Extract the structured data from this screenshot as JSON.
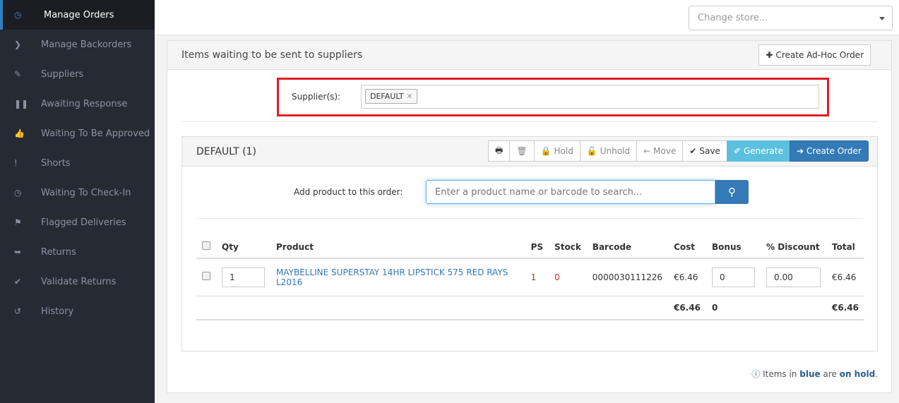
{
  "sidebar": {
    "items": [
      {
        "label": "Manage Orders",
        "icon": "clock-icon",
        "glyph": "◷",
        "active": true
      },
      {
        "label": "Manage Backorders",
        "icon": "chevron-right-icon",
        "glyph": "❯"
      },
      {
        "label": "Suppliers",
        "icon": "edit-icon",
        "glyph": "✎"
      },
      {
        "label": "Awaiting Response",
        "icon": "pause-icon",
        "glyph": "❚❚"
      },
      {
        "label": "Waiting To Be Approved",
        "icon": "thumbs-up-icon",
        "glyph": "👍"
      },
      {
        "label": "Shorts",
        "icon": "exclamation-icon",
        "glyph": "!"
      },
      {
        "label": "Waiting To Check-In",
        "icon": "clock-icon",
        "glyph": "◷"
      },
      {
        "label": "Flagged Deliveries",
        "icon": "flag-icon",
        "glyph": "⚑"
      },
      {
        "label": "Returns",
        "icon": "sign-out-icon",
        "glyph": "➥"
      },
      {
        "label": "Validate Returns",
        "icon": "check-icon",
        "glyph": "✔"
      },
      {
        "label": "History",
        "icon": "history-icon",
        "glyph": "↺"
      }
    ]
  },
  "topbar": {
    "store_placeholder": "Change store..."
  },
  "panel": {
    "title": "Items waiting to be sent to suppliers",
    "adhoc_label": "Create Ad-Hoc Order",
    "supplier_label": "Supplier(s):",
    "supplier_tag": "DEFAULT"
  },
  "order": {
    "title": "DEFAULT (1)",
    "tools": {
      "hold": "Hold",
      "unhold": "Unhold",
      "move": "Move",
      "save": "Save",
      "generate": "Generate",
      "create": "Create Order"
    },
    "add_label": "Add product to this order:",
    "search_placeholder": "Enter a product name or barcode to search...",
    "columns": [
      "Qty",
      "Product",
      "PS",
      "Stock",
      "Barcode",
      "Cost",
      "Bonus",
      "% Discount",
      "Total"
    ],
    "row": {
      "qty": "1",
      "product": "MAYBELLINE SUPERSTAY 14HR LIPSTICK 575 RED RAYS L2016",
      "ps": "1",
      "stock": "0",
      "barcode": "0000030111226",
      "cost": "€6.46",
      "bonus": "0",
      "discount": "0.00",
      "total": "€6.46"
    },
    "totals": {
      "cost": "€6.46",
      "bonus": "0",
      "total": "€6.46"
    }
  },
  "note": {
    "prefix": "Items in",
    "blue": "blue",
    "mid": "are",
    "hold": "on hold",
    "suffix": "."
  },
  "colors": {
    "sidebar": "#262a33",
    "accent": "#337ab7",
    "highlight": "#e01b24",
    "stock_zero": "#c9302c"
  }
}
